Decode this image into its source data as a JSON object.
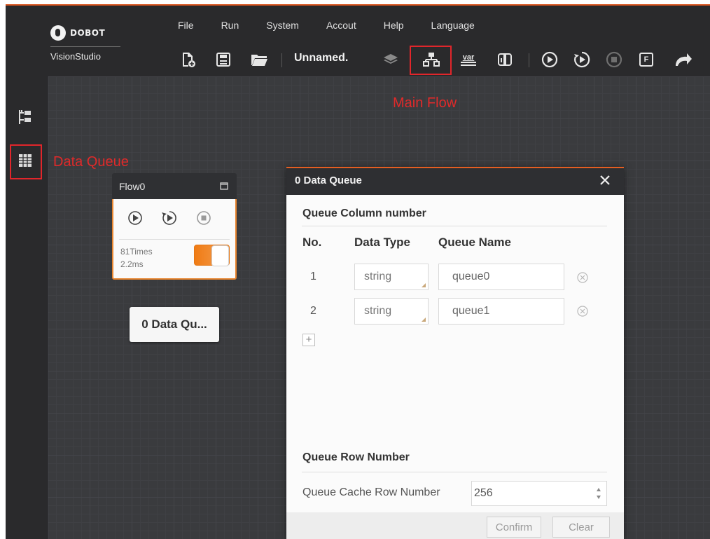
{
  "app": {
    "logo_brand": "DOBOT",
    "logo_product": "VisionStudio"
  },
  "menu": [
    "File",
    "Run",
    "System",
    "Accout",
    "Help",
    "Language"
  ],
  "toolbar": {
    "solution_name": "Unnamed.",
    "var_label": "var",
    "f_label": "F",
    "icons": [
      "new-solution-icon",
      "save-icon",
      "open-folder-icon",
      "layers-icon",
      "main-flow-icon",
      "global-variable-icon",
      "communication-icon",
      "run-once-icon",
      "run-loop-icon",
      "stop-icon",
      "function-icon",
      "undo-icon"
    ],
    "highlighted": "main-flow-icon"
  },
  "sidebar": {
    "icons": [
      "process-tree-icon",
      "data-queue-icon"
    ],
    "highlighted": "data-queue-icon"
  },
  "annotations": {
    "main_flow": "Main Flow",
    "data_queue": "Data Queue",
    "color": "#e02a2a"
  },
  "flow_card": {
    "title": "Flow0",
    "times": "81Times",
    "duration": "2.2ms",
    "toggle_on": true,
    "accent": "#f07b14"
  },
  "data_queue_node": {
    "label": "0 Data Qu..."
  },
  "dialog": {
    "title": "0 Data Queue",
    "column_section": "Queue Column number",
    "columns": {
      "no": "No.",
      "type": "Data Type",
      "name": "Queue Name"
    },
    "rows": [
      {
        "no": "1",
        "type": "string",
        "name": "queue0"
      },
      {
        "no": "2",
        "type": "string",
        "name": "queue1"
      }
    ],
    "add_label": "+",
    "row_section": "Queue Row Number",
    "cache_label": "Queue Cache Row Number",
    "cache_value": "256",
    "confirm_label": "Confirm",
    "clear_label": "Clear"
  }
}
